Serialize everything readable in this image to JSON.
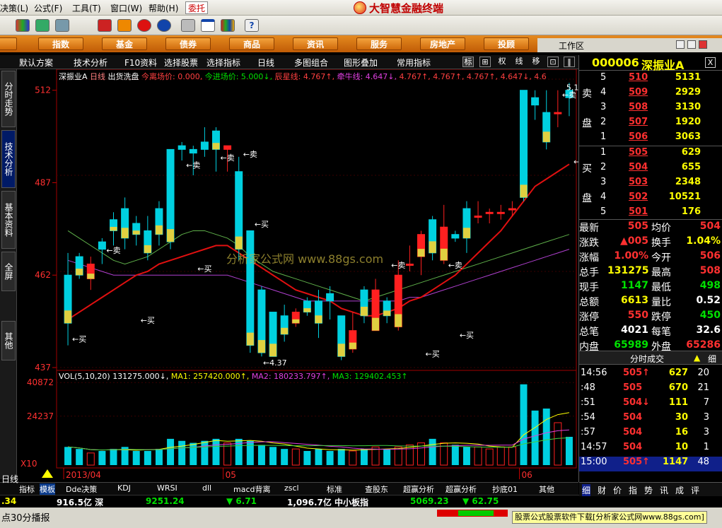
{
  "menu": {
    "items": [
      "决策(L)",
      "公式(F)",
      "工具(T)",
      "窗口(W)",
      "帮助(H)"
    ],
    "trust": "委托",
    "brand": "大智慧金融终端"
  },
  "nav": {
    "items": [
      "股",
      "指数",
      "基金",
      "债券",
      "商品",
      "资讯",
      "服务",
      "房地产",
      "投顾"
    ],
    "work_area": "工作区"
  },
  "chart_toolbar": {
    "items": [
      "默认方案",
      "技术分析",
      "F10资料",
      "选择股票",
      "选择指标",
      "日线",
      "多图组合",
      "图形叠加",
      "常用指标"
    ],
    "mini": [
      "标",
      "权",
      "线",
      "移"
    ]
  },
  "left_tabs": [
    "分时走势",
    "技术分析",
    "基本资料",
    "全屏",
    "其他"
  ],
  "kline": {
    "header_stock": "深振业A",
    "header_period": "日线",
    "header_text": "出货洗盘",
    "today_in": "今离场价: 0.000,",
    "today_enter": "今进场价: 5.000↓,",
    "star_line": "辰星线: 4.767↑,",
    "cow_line": "牵牛线: 4.647↓,",
    "extra_vals": "4.767↑, 4.767↑, 4.767↑, 4.647↓, 4.6",
    "y_labels": [
      "512",
      "487",
      "462",
      "437"
    ],
    "last_value": "5.12",
    "low_label": "4.37",
    "buy": "买",
    "sell": "卖",
    "watermark": "分析家公式网 www.88gs.com"
  },
  "volume": {
    "legend_base": "VOL(5,10,20)",
    "vol": "131275.000↓,",
    "ma1": "MA1: 257420.000↑,",
    "ma2": "MA2: 180233.797↑,",
    "ma3": "MA3: 129402.453↑",
    "y_labels": [
      "40872",
      "24237"
    ],
    "x10": "X10",
    "month_labels": [
      "2013/04",
      "05",
      "06"
    ]
  },
  "chart_data": {
    "type": "candlestick",
    "ylim": [
      437,
      515
    ],
    "up_color": "#ff2020",
    "down_color": "#00d0e0",
    "candles": [
      [
        462,
        449,
        443,
        468
      ],
      [
        467,
        462,
        461,
        468
      ],
      [
        461,
        465,
        458,
        467
      ],
      [
        471,
        469,
        465,
        472
      ],
      [
        477,
        474,
        470,
        479
      ],
      [
        480,
        472,
        469,
        483
      ],
      [
        476,
        473,
        470,
        478
      ],
      [
        474,
        468,
        466,
        478
      ],
      [
        480,
        473,
        470,
        482
      ],
      [
        496,
        471,
        469,
        496
      ],
      [
        497,
        496,
        493,
        498
      ],
      [
        496,
        495,
        489,
        497
      ],
      [
        498,
        496,
        494,
        502
      ],
      [
        501,
        496,
        490,
        502
      ],
      [
        496,
        497,
        490,
        497
      ],
      [
        490,
        469,
        466,
        494
      ],
      [
        474,
        443,
        441,
        474
      ],
      [
        458,
        441,
        440,
        459
      ],
      [
        452,
        440,
        440,
        446
      ],
      [
        451,
        446,
        444,
        454
      ],
      [
        449,
        452,
        448,
        453
      ],
      [
        455,
        452,
        451,
        456
      ],
      [
        455,
        449,
        445,
        458
      ],
      [
        457,
        455,
        450,
        459
      ],
      [
        451,
        440,
        439,
        451
      ],
      [
        442,
        447,
        441,
        452
      ],
      [
        458,
        451,
        449,
        459
      ],
      [
        447,
        458,
        448,
        461
      ],
      [
        455,
        451,
        449,
        456
      ],
      [
        448,
        462,
        447,
        466
      ],
      [
        465,
        465,
        463,
        470
      ],
      [
        467,
        473,
        462,
        474
      ],
      [
        477,
        468,
        466,
        478
      ],
      [
        466,
        475,
        465,
        481
      ],
      [
        473,
        472,
        471,
        474
      ],
      [
        480,
        472,
        468,
        482
      ],
      [
        478,
        478,
        476,
        482
      ],
      [
        479,
        479,
        476,
        480
      ],
      [
        479,
        479,
        477,
        481
      ],
      [
        480,
        480,
        478,
        482
      ],
      [
        512,
        483,
        482,
        512
      ],
      [
        510,
        508,
        504,
        512
      ],
      [
        506,
        498,
        496,
        512
      ],
      [
        506,
        506,
        502,
        512
      ],
      [
        512,
        510,
        505,
        514
      ]
    ],
    "ma_red": [
      450,
      452,
      454,
      456,
      458,
      460,
      462,
      463,
      465,
      466,
      467,
      468,
      469,
      470,
      470,
      468,
      466,
      464,
      462,
      460,
      458,
      457,
      456,
      455,
      453,
      452,
      451,
      451,
      452,
      453,
      455,
      456,
      458,
      460,
      462,
      465,
      468,
      471,
      474,
      478,
      482,
      486,
      488,
      490,
      492
    ],
    "ma_purple": [
      466,
      465,
      464,
      463,
      462,
      462,
      462,
      462,
      462,
      462,
      462,
      462,
      462,
      462,
      462,
      461,
      460,
      459,
      458,
      457,
      456,
      455,
      455,
      455,
      455,
      455,
      455,
      455,
      455,
      455,
      456,
      456,
      457,
      458,
      459,
      460,
      461,
      462,
      463,
      464,
      465,
      466,
      467,
      468,
      469
    ],
    "ma_green": [
      474,
      472,
      470,
      468,
      466,
      465,
      466,
      467,
      469,
      471,
      473,
      474,
      474,
      473,
      472,
      470,
      467,
      465,
      463,
      462,
      461,
      460,
      459,
      458,
      457,
      456,
      455,
      456,
      457,
      458,
      459,
      460,
      461,
      462,
      463,
      464,
      465,
      466,
      467,
      468,
      469,
      470,
      471,
      472,
      473
    ],
    "volumes": [
      9,
      8,
      6,
      7,
      8,
      9,
      7,
      7,
      8,
      13,
      12,
      11,
      12,
      13,
      11,
      13,
      12,
      10,
      9,
      8,
      8,
      7,
      8,
      7,
      8,
      7,
      8,
      9,
      8,
      9,
      10,
      11,
      13,
      11,
      10,
      9,
      9,
      8,
      9,
      9,
      40,
      27,
      28,
      21,
      14
    ]
  },
  "right": {
    "code": "000006",
    "name": "深振业A",
    "close_x": "X",
    "sell_label": [
      "卖",
      "盘"
    ],
    "buy_label": [
      "买",
      "盘"
    ],
    "asks": [
      {
        "lv": "5",
        "price": "510",
        "vol": "5131"
      },
      {
        "lv": "4",
        "price": "509",
        "vol": "2929"
      },
      {
        "lv": "3",
        "price": "508",
        "vol": "3130"
      },
      {
        "lv": "2",
        "price": "507",
        "vol": "1920"
      },
      {
        "lv": "1",
        "price": "506",
        "vol": "3063"
      }
    ],
    "bids": [
      {
        "lv": "1",
        "price": "505",
        "vol": "629"
      },
      {
        "lv": "2",
        "price": "504",
        "vol": "655"
      },
      {
        "lv": "3",
        "price": "503",
        "vol": "2348"
      },
      {
        "lv": "4",
        "price": "502",
        "vol": "10521"
      },
      {
        "lv": "5",
        "price": "501",
        "vol": "176"
      }
    ],
    "stats": [
      {
        "k": "最新",
        "v": "505",
        "vc": "red",
        "k2": "均价",
        "v2": "504",
        "v2c": "red"
      },
      {
        "k": "涨跌",
        "v": "▲005",
        "vc": "red",
        "k2": "换手",
        "v2": "1.04%",
        "v2c": "yellow"
      },
      {
        "k": "涨幅",
        "v": "1.00%",
        "vc": "red",
        "k2": "今开",
        "v2": "506",
        "v2c": "red"
      },
      {
        "k": "总手",
        "v": "131275",
        "vc": "yellow",
        "k2": "最高",
        "v2": "508",
        "v2c": "red"
      },
      {
        "k": "现手",
        "v": "1147",
        "vc": "green",
        "k2": "最低",
        "v2": "498",
        "v2c": "green"
      },
      {
        "k": "总额",
        "v": "6613",
        "vc": "yellow",
        "k2": "量比",
        "v2": "0.52",
        "v2c": "white"
      },
      {
        "k": "涨停",
        "v": "550",
        "vc": "red",
        "k2": "跌停",
        "v2": "450",
        "v2c": "green"
      },
      {
        "k": "总笔",
        "v": "4021",
        "vc": "white",
        "k2": "每笔",
        "v2": "32.6",
        "v2c": "white"
      },
      {
        "k": "内盘",
        "v": "65989",
        "vc": "green",
        "k2": "外盘",
        "v2": "65286",
        "v2c": "red"
      }
    ],
    "ticks_title": "分时成交",
    "ticks_side": "细",
    "ticks": [
      {
        "t": "14:56",
        "p": "505↑",
        "pc": "red",
        "q": "627",
        "n": "20"
      },
      {
        "t": ":48",
        "p": "505",
        "pc": "red",
        "q": "670",
        "n": "21"
      },
      {
        "t": ":51",
        "p": "504↓",
        "pc": "red",
        "q": "111",
        "n": "7"
      },
      {
        "t": ":54",
        "p": "504",
        "pc": "red",
        "q": "30",
        "n": "3"
      },
      {
        "t": ":57",
        "p": "504",
        "pc": "red",
        "q": "16",
        "n": "3"
      },
      {
        "t": "14:57",
        "p": "504",
        "pc": "red",
        "q": "10",
        "n": "1"
      },
      {
        "t": "15:00",
        "p": "505↑",
        "pc": "red",
        "q": "1147",
        "n": "48"
      }
    ],
    "tabs": [
      "细",
      "财",
      "价",
      "指",
      "势",
      "讯",
      "成",
      "评"
    ]
  },
  "bottom_tabs": [
    "日线",
    "指标",
    "模板",
    "Dde决策",
    "KDJ",
    "WRSI",
    "dll",
    "macd背离",
    "zscl",
    "标准",
    "查股东",
    "超赢分析",
    "超赢分析",
    "抄底01",
    "其他"
  ],
  "index_bar": [
    {
      "text": ".34",
      "c": "yellow"
    },
    {
      "text": "916.5亿 深",
      "c": "white"
    },
    {
      "text": "9251.24",
      "c": "green"
    },
    {
      "text": "▼ 6.71",
      "c": "green"
    },
    {
      "text": "1,096.7亿 中小板指",
      "c": "white"
    },
    {
      "text": "5069.23",
      "c": "green"
    },
    {
      "text": "▼ 62.75",
      "c": "green"
    }
  ],
  "status": {
    "left": "点30分播报",
    "ad": "股票公式股票软件下载[分析家公式网www.88gs.com]"
  }
}
